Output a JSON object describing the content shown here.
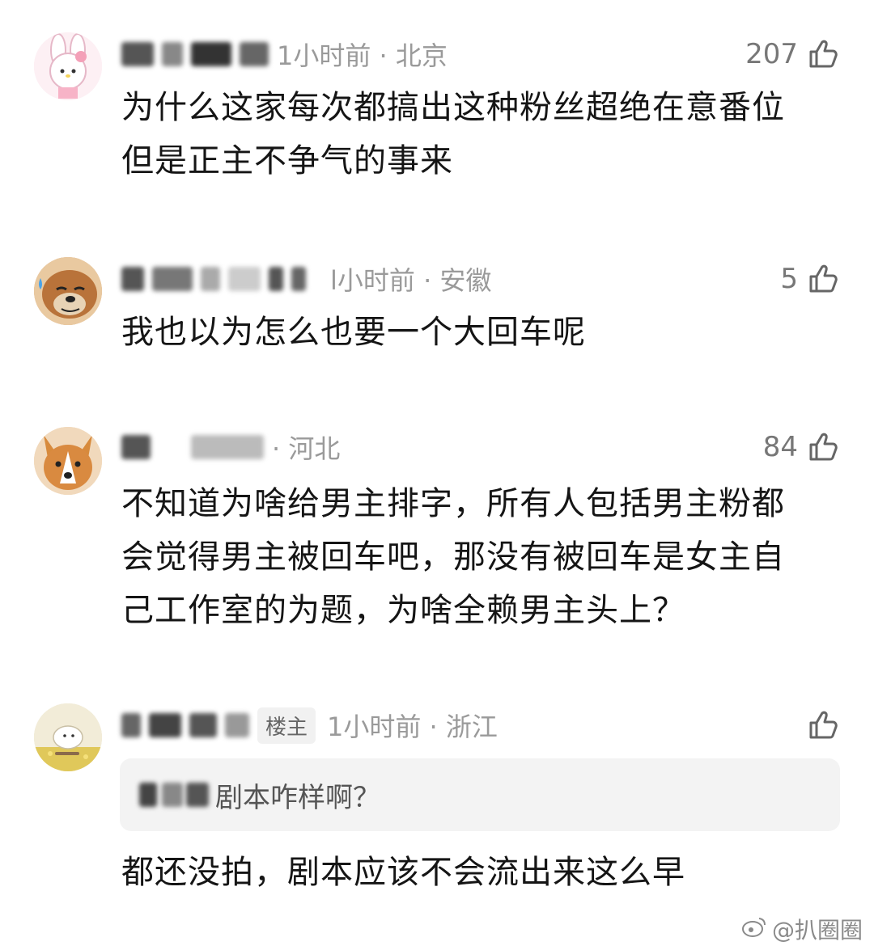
{
  "comments": [
    {
      "meta": "1小时前 · 北京",
      "likes": "207",
      "text_lines": [
        "为什么这家每次都搞出这种粉丝超绝在意番位",
        "但是正主不争气的事来"
      ]
    },
    {
      "meta": "l小时前 · 安徽",
      "likes": "5",
      "text_lines": [
        "我也以为怎么也要一个大回车呢"
      ]
    },
    {
      "meta": "· 河北",
      "likes": "84",
      "text_lines": [
        "不知道为啥给男主排字，所有人包括男主粉都",
        "会觉得男主被回车吧，那没有被回车是女主自",
        "己工作室的为题，为啥全赖男主头上？"
      ]
    },
    {
      "badge": "楼主",
      "meta": "1小时前 · 浙江",
      "quote": "剧本咋样啊？",
      "text_lines": [
        "都还没拍，剧本应该不会流出来这么早"
      ]
    }
  ],
  "watermark": "@扒圈圈",
  "icons": {
    "like": "thumbs-up-icon",
    "weibo": "weibo-logo-icon"
  },
  "colors": {
    "meta_gray": "#9a9a9a",
    "quote_bg": "#f3f3f3"
  }
}
